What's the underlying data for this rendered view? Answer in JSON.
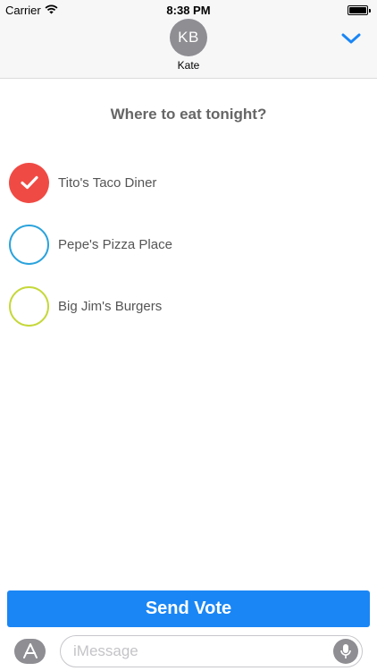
{
  "status_bar": {
    "carrier": "Carrier",
    "time": "8:38 PM",
    "wifi_icon": "wifi-icon",
    "battery_level": 1.0
  },
  "header": {
    "avatar_initials": "KB",
    "contact_name": "Kate",
    "collapse_icon": "chevron-down-icon",
    "accent_color": "#1a86f5"
  },
  "poll": {
    "question": "Where to eat tonight?",
    "options": [
      {
        "label": "Tito's Taco Diner",
        "selected": true,
        "color": "#f04a44"
      },
      {
        "label": "Pepe's Pizza Place",
        "selected": false,
        "color": "#2ba3dc"
      },
      {
        "label": "Big Jim's Burgers",
        "selected": false,
        "color": "#c5d83a"
      }
    ]
  },
  "send_button": {
    "label": "Send Vote",
    "color": "#1a86f5"
  },
  "input_bar": {
    "placeholder": "iMessage",
    "appstore_icon": "app-store-icon",
    "mic_icon": "microphone-icon"
  }
}
